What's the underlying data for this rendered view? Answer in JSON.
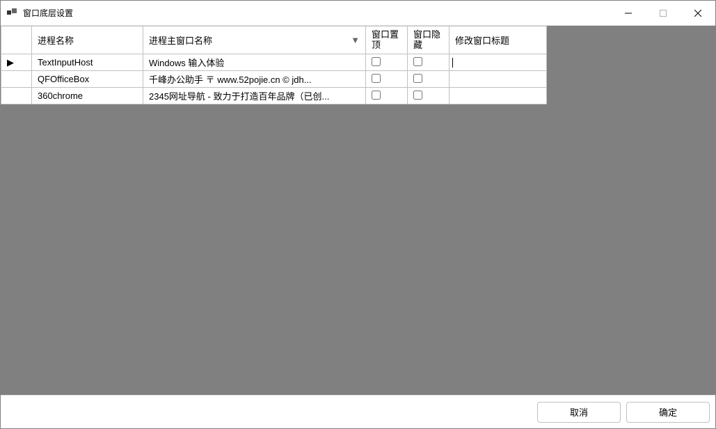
{
  "window": {
    "title": "窗口底层设置"
  },
  "columns": {
    "process": "进程名称",
    "mainWindow": "进程主窗口名称",
    "topLine1": "窗口置",
    "topLine2": "顶",
    "hideLine1": "窗口隐",
    "hideLine2": "藏",
    "editTitle": "修改窗口标题"
  },
  "rows": [
    {
      "marker": "▶",
      "process": "TextInputHost",
      "mainWindow": "Windows 输入体验",
      "editTitle": ""
    },
    {
      "marker": "",
      "process": "QFOfficeBox",
      "mainWindow": "千峰办公助手   〒 www.52pojie.cn © jdh...",
      "editTitle": ""
    },
    {
      "marker": "",
      "process": "360chrome",
      "mainWindow": "2345网址导航 - 致力于打造百年品牌（已创...",
      "editTitle": ""
    }
  ],
  "buttons": {
    "cancel": "取消",
    "ok": "确定"
  }
}
